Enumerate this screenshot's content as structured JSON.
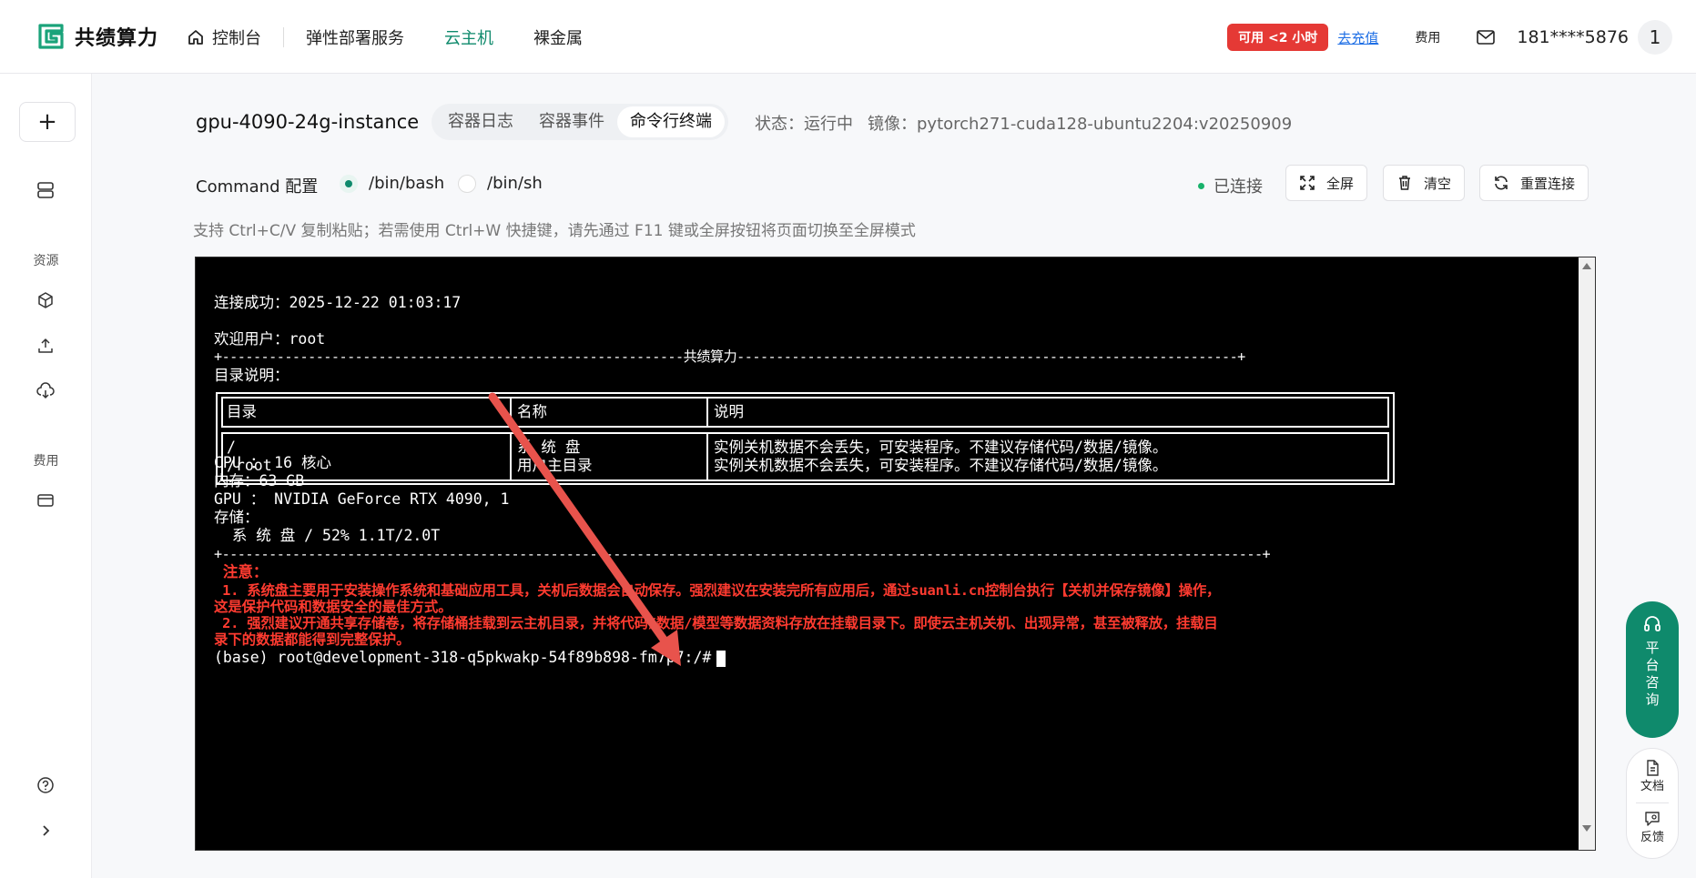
{
  "brand": {
    "name": "共绩算力"
  },
  "nav": {
    "console": "控制台",
    "elastic": "弹性部署服务",
    "cloud": "云主机",
    "bare": "裸金属"
  },
  "topright": {
    "badge": "可用 <2 小时",
    "recharge": "去充值",
    "fee": "费用",
    "phone": "181****5876",
    "avatar": "1"
  },
  "sidebar": {
    "plus": "+",
    "resources_label": "资源",
    "fees_label": "费用"
  },
  "instance": {
    "name": "gpu-4090-24g-instance"
  },
  "tabs": [
    "容器日志",
    "容器事件",
    "命令行终端"
  ],
  "status_text": "状态：运行中",
  "image_text": "镜像：pytorch271-cuda128-ubuntu2204:v20250909",
  "command": {
    "label": "Command 配置",
    "options": [
      "/bin/bash",
      "/bin/sh"
    ],
    "selected": "/bin/bash"
  },
  "connection": {
    "status": "已连接"
  },
  "buttons": {
    "fullscreen": "全屏",
    "clear": "清空",
    "reconnect": "重置连接"
  },
  "hint": "支持 Ctrl+C/V 复制粘贴；若需使用 Ctrl+W 快捷键，请先通过 F11 键或全屏按钮将页面切换至全屏模式",
  "terminal": {
    "line_connect": "连接成功：2025-12-22 01:03:17",
    "line_welcome": "欢迎用户：root",
    "line_border_top": "+-----------------------------------------------------------共绩算力----------------------------------------------------------------+",
    "line_dir": "目录说明：",
    "table": {
      "headers": [
        "目录",
        "名称",
        "说明"
      ],
      "rows_col1": "/\n/root",
      "rows_col2": "系 统 盘\n用户主目录",
      "rows_col3": "实例关机数据不会丢失，可安装程序。不建议存储代码/数据/镜像。\n实例关机数据不会丢失，可安装程序。不建议存储代码/数据/镜像。"
    },
    "line_cpu": "CPU ： 16 核心",
    "line_mem": "内存：63 GB",
    "line_gpu": "GPU ： NVIDIA GeForce RTX 4090, 1",
    "line_storage": "存储：",
    "line_disk": "  系 统 盘 / 52% 1.1T/2.0T",
    "line_border_bottom": "+-------------------------------------------------------------------------------------------------------------------------------------+",
    "notice_title": " 注意：",
    "notice_1a": " 1. 系统盘主要用于安装操作系统和基础应用工具，关机后数据会自动保存。强烈建议在安装完所有应用后，通过suanli.cn控制台执行【关机并保存镜像】操作，",
    "notice_1b": "这是保护代码和数据安全的最佳方式。",
    "notice_2a": " 2. 强烈建议开通共享存储卷，将存储桶挂载到云主机目录，并将代码/数据/模型等数据资料存放在挂载目录下。即使云主机关机、出现异常，甚至被释放，挂载目",
    "notice_2b": "录下的数据都能得到完整保护。",
    "prompt": "(base) root@development-318-q5pkwakp-54f89b898-fm7p7:/#"
  },
  "float": {
    "consult": "平台咨询",
    "docs": "文档",
    "feedback": "反馈"
  },
  "colors": {
    "accent": "#0f8a6c",
    "danger": "#e53935",
    "link": "#1f6fe5",
    "annotation_arrow": "#e8534c"
  }
}
